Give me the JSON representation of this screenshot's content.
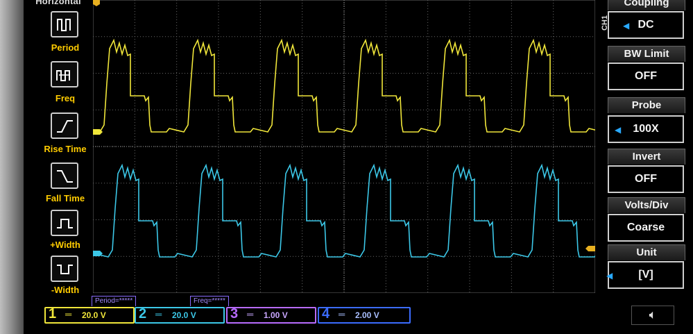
{
  "left_menu": {
    "title": "Horizontal",
    "items": [
      {
        "label": "Period",
        "icon": "period-icon"
      },
      {
        "label": "Freq",
        "icon": "frequency-icon"
      },
      {
        "label": "Rise Time",
        "icon": "rise-time-icon"
      },
      {
        "label": "Fall Time",
        "icon": "fall-time-icon"
      },
      {
        "label": "+Width",
        "icon": "positive-width-icon"
      },
      {
        "label": "-Width",
        "icon": "negative-width-icon"
      }
    ]
  },
  "right_menu": {
    "channel_tag": "CH1",
    "items": [
      {
        "title": "Coupling",
        "value": "DC"
      },
      {
        "title": "BW Limit",
        "value": "OFF"
      },
      {
        "title": "Probe",
        "value": "100X"
      },
      {
        "title": "Invert",
        "value": "OFF"
      },
      {
        "title": "Volts/Div",
        "value": "Coarse"
      },
      {
        "title": "Unit",
        "value": "[V]"
      }
    ]
  },
  "measurements": {
    "period": "Period=*****",
    "freq": "Freq=*****"
  },
  "channels": [
    {
      "num": "1",
      "scale": "20.0 V",
      "color": "#f0e63a"
    },
    {
      "num": "2",
      "scale": "20.0 V",
      "color": "#3cc8e8"
    },
    {
      "num": "3",
      "scale": "1.00 V",
      "color": "#b86bff"
    },
    {
      "num": "4",
      "scale": "2.00 V",
      "color": "#3b6cff"
    }
  ],
  "colors": {
    "ch1_trace": "#f0e63a",
    "ch2_trace": "#3cc8e8",
    "grid": "#6a6a6a",
    "menu_label": "#ffcc00",
    "arrow": "#29a9ff"
  }
}
